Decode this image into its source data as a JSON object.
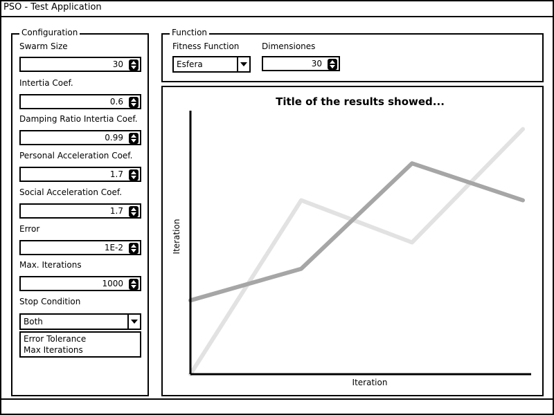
{
  "window": {
    "title": "PSO - Test Application"
  },
  "configuration": {
    "legend": "Configuration",
    "fields": [
      {
        "label": "Swarm Size",
        "value": "30"
      },
      {
        "label": "Intertia Coef.",
        "value": "0.6"
      },
      {
        "label": "Damping Ratio Intertia Coef.",
        "value": "0.99"
      },
      {
        "label": "Personal Acceleration Coef.",
        "value": "1.7"
      },
      {
        "label": "Social Acceleration Coef.",
        "value": "1.7"
      },
      {
        "label": "Error",
        "value": "1E-2"
      },
      {
        "label": "Max. Iterations",
        "value": "1000"
      }
    ],
    "stop_condition": {
      "label": "Stop Condition",
      "selected": "Both",
      "options": [
        "Error Tolerance",
        "Max Iterations"
      ]
    }
  },
  "function": {
    "legend": "Function",
    "fitness_label": "Fitness Function",
    "fitness_value": "Esfera",
    "dims_label": "Dimensiones",
    "dims_value": "30"
  },
  "chart_data": {
    "type": "line",
    "title": "Title of the results showed...",
    "xlabel": "Iteration",
    "ylabel": "Iteration",
    "x": [
      0,
      1,
      2,
      3
    ],
    "ylim": [
      0,
      10
    ],
    "series": [
      {
        "values": [
          0,
          6.6,
          5.0,
          9.3
        ],
        "color": "#e2e2e2"
      },
      {
        "values": [
          2.8,
          4.0,
          8.0,
          6.6
        ],
        "color": "#a6a6a6"
      }
    ],
    "grid": false
  }
}
